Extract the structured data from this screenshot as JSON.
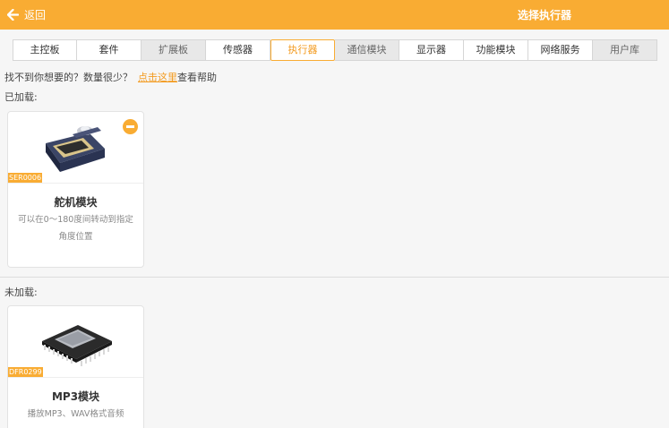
{
  "header": {
    "back_label": "返回",
    "title": "选择执行器"
  },
  "tabs": [
    {
      "label": "主控板",
      "state": "normal"
    },
    {
      "label": "套件",
      "state": "normal"
    },
    {
      "label": "扩展板",
      "state": "gray"
    },
    {
      "label": "传感器",
      "state": "normal"
    },
    {
      "label": "执行器",
      "state": "active"
    },
    {
      "label": "通信模块",
      "state": "gray"
    },
    {
      "label": "显示器",
      "state": "normal"
    },
    {
      "label": "功能模块",
      "state": "normal"
    },
    {
      "label": "网络服务",
      "state": "normal"
    },
    {
      "label": "用户库",
      "state": "gray"
    }
  ],
  "help": {
    "prefix": "找不到你想要的？数量很少？",
    "link": "点击这里",
    "suffix": "查看帮助"
  },
  "loaded": {
    "label": "已加载:",
    "cards": [
      {
        "tag": "SER0006",
        "name": "舵机模块",
        "desc": "可以在0～180度间转动到指定角度位置"
      }
    ]
  },
  "unloaded": {
    "label": "未加载:",
    "cards": [
      {
        "tag": "DFR0299",
        "name": "MP3模块",
        "desc": "播放MP3、WAV格式音频"
      }
    ]
  },
  "colors": {
    "accent": "#f9ac33",
    "active_text": "#f39a1e"
  },
  "icons": {
    "back": "arrow-left-icon",
    "remove": "minus-circle-icon"
  }
}
